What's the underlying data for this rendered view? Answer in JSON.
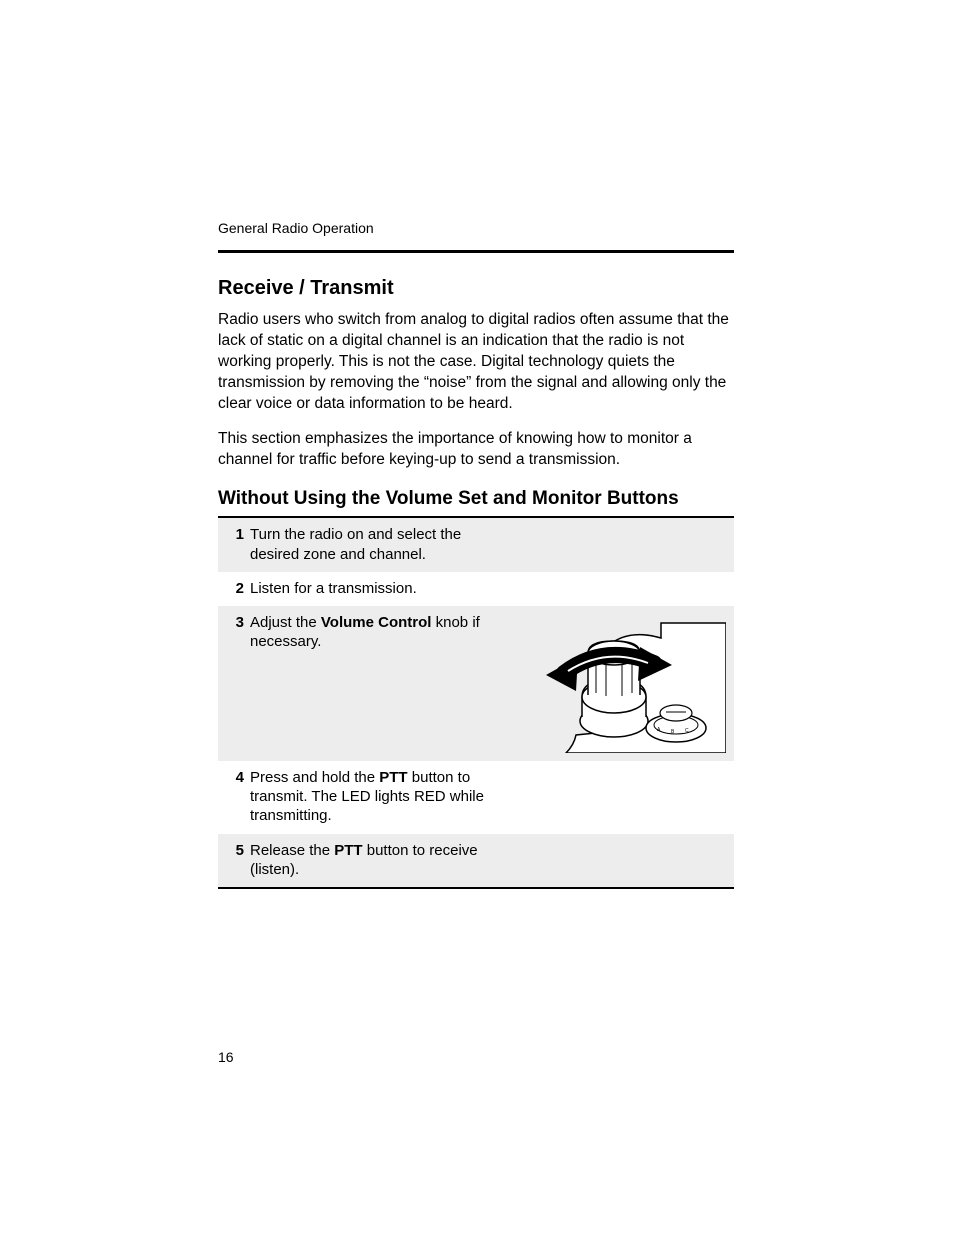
{
  "header": {
    "running_head": "General Radio Operation"
  },
  "section": {
    "title": "Receive / Transmit",
    "para1": "Radio users who switch from analog to digital radios often assume that the lack of static on a digital channel is an indication that the radio is not working properly. This is not the case. Digital technology quiets the transmission by removing the “noise” from the signal and allowing only the clear voice or data information to be heard.",
    "para2": "This section emphasizes the importance of knowing how to monitor a channel for traffic before keying-up to send a transmission."
  },
  "subsection": {
    "title": "Without Using the Volume Set and Monitor Buttons",
    "steps": [
      {
        "n": "1",
        "pre": "Turn the radio on and select the desired zone and channel.",
        "bold": "",
        "post": ""
      },
      {
        "n": "2",
        "pre": "Listen for a transmission.",
        "bold": "",
        "post": ""
      },
      {
        "n": "3",
        "pre": "Adjust the ",
        "bold": "Volume Control",
        "post": " knob if necessary."
      },
      {
        "n": "4",
        "pre": "Press and hold the ",
        "bold": "PTT",
        "post": " button to transmit. The LED lights RED while transmitting."
      },
      {
        "n": "5",
        "pre": "Release the ",
        "bold": "PTT",
        "post": " button to receive (listen)."
      }
    ]
  },
  "footer": {
    "page_number": "16"
  }
}
